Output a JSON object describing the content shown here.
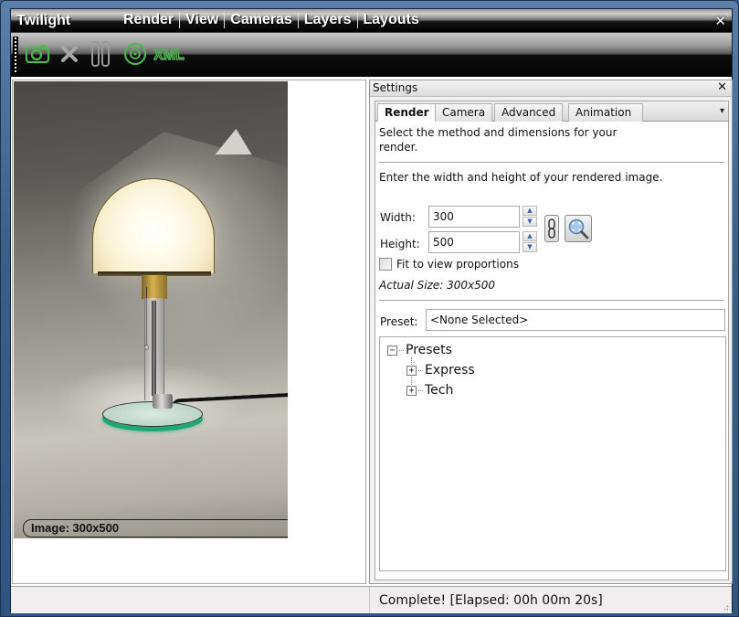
{
  "window": {
    "app_title": "Twilight",
    "close_glyph": "✕"
  },
  "menu": [
    {
      "label": "Render"
    },
    {
      "label": "View"
    },
    {
      "label": "Cameras"
    },
    {
      "label": "Layers"
    },
    {
      "label": "Layouts"
    }
  ],
  "toolbar": {
    "buttons": [
      {
        "name": "render-camera",
        "icon": "camera-icon",
        "color": "#4fb44f"
      },
      {
        "name": "cancel",
        "icon": "close-icon",
        "color": "#9a9a9a"
      },
      {
        "name": "pause",
        "icon": "pause-icon",
        "color": "#9a9a9a"
      },
      {
        "name": "disc",
        "icon": "disc-icon",
        "color": "#4fb44f"
      },
      {
        "name": "xml-export",
        "icon": "xml-icon",
        "label": "XML",
        "color": "#4fb44f"
      }
    ]
  },
  "preview": {
    "caption": "Image: 300x500"
  },
  "settings": {
    "title": "Settings",
    "close_glyph": "✕",
    "tabs": [
      {
        "label": "Render",
        "active": true
      },
      {
        "label": "Camera",
        "active": false
      },
      {
        "label": "Advanced",
        "active": false
      },
      {
        "label": "Animation",
        "active": false
      }
    ],
    "overflow_glyph": "▾",
    "render": {
      "description": "Select the method and dimensions for your render.",
      "instruction": "Enter the width and height of your rendered image.",
      "width_label": "Width:",
      "width_value": "300",
      "height_label": "Height:",
      "height_value": "500",
      "spin_up": "▲",
      "spin_down": "▼",
      "fit_label": "Fit to view proportions",
      "fit_checked": false,
      "actual_size": "Actual Size: 300x500",
      "preset_label": "Preset:",
      "preset_value": "<None Selected>",
      "tree": {
        "root": {
          "label": "Presets",
          "toggle": "−"
        },
        "children": [
          {
            "label": "Express",
            "toggle": "+"
          },
          {
            "label": "Tech",
            "toggle": "+"
          }
        ]
      }
    }
  },
  "status": {
    "text": "Complete!  [Elapsed: 00h 00m 20s]"
  }
}
